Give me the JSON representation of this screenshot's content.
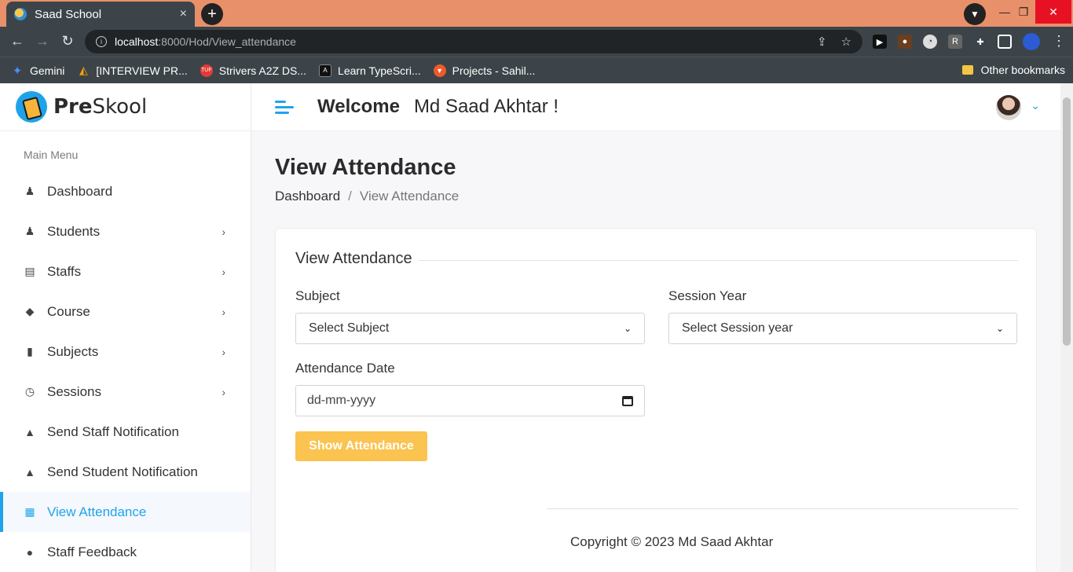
{
  "browser": {
    "tab_title": "Saad School",
    "tab_close": "×",
    "new_tab": "+",
    "url_host": "localhost",
    "url_path": ":8000/Hod/View_attendance",
    "bookmarks": [
      {
        "label": "Gemini",
        "color": "#4c8df6"
      },
      {
        "label": "[INTERVIEW PR...",
        "color": "#f4a300"
      },
      {
        "label": "Strivers A2Z DS...",
        "color": "#e53935"
      },
      {
        "label": "Learn TypeScri...",
        "color": "#111111"
      },
      {
        "label": "Projects - Sahil...",
        "color": "#f05a28"
      }
    ],
    "other_bookmarks": "Other bookmarks"
  },
  "logo": {
    "pre": "Pre",
    "skool": "Skool"
  },
  "sidebar": {
    "menu_title": "Main Menu",
    "items": [
      {
        "label": "Dashboard",
        "icon": "user-graduate-icon",
        "chevron": ""
      },
      {
        "label": "Students",
        "icon": "user-graduate-icon",
        "chevron": "›"
      },
      {
        "label": "Staffs",
        "icon": "chalkboard-teacher-icon",
        "chevron": "›"
      },
      {
        "label": "Course",
        "icon": "graduation-cap-icon",
        "chevron": "›"
      },
      {
        "label": "Subjects",
        "icon": "book-reader-icon",
        "chevron": "›"
      },
      {
        "label": "Sessions",
        "icon": "clock-icon",
        "chevron": "›"
      },
      {
        "label": "Send Staff Notification",
        "icon": "bell-icon",
        "chevron": ""
      },
      {
        "label": "Send Student Notification",
        "icon": "bell-icon",
        "chevron": ""
      },
      {
        "label": "View Attendance",
        "icon": "calendar-icon",
        "chevron": ""
      },
      {
        "label": "Staff Feedback",
        "icon": "comments-icon",
        "chevron": ""
      }
    ]
  },
  "header": {
    "welcome": "Welcome",
    "username": "Md Saad Akhtar !"
  },
  "page": {
    "title": "View Attendance",
    "breadcrumb_home": "Dashboard",
    "breadcrumb_sep": "/",
    "breadcrumb_current": "View Attendance"
  },
  "form": {
    "legend": "View Attendance",
    "subject_label": "Subject",
    "subject_value": "Select Subject",
    "session_label": "Session Year",
    "session_value": "Select Session year",
    "date_label": "Attendance Date",
    "date_placeholder": "dd-mm-yyyy",
    "submit_label": "Show Attendance"
  },
  "footer": {
    "copyright": "Copyright © 2023 Md Saad Akhtar"
  },
  "colors": {
    "accent": "#20a3ec",
    "button": "#fbc34f",
    "tabbar": "#e8906a"
  }
}
